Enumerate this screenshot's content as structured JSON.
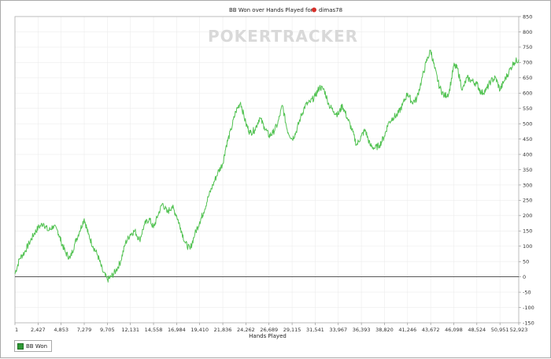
{
  "chart_data": {
    "type": "line",
    "title_prefix": "BB Won over Hands Played for",
    "title_player": "dimas78",
    "watermark": "POKERTRACKER",
    "xlabel": "Hands Played",
    "ylabel": "",
    "x_ticks": [
      "1",
      "2,427",
      "4,853",
      "7,279",
      "9,705",
      "12,131",
      "14,558",
      "16,984",
      "19,410",
      "21,836",
      "24,262",
      "26,689",
      "29,115",
      "31,541",
      "33,967",
      "36,393",
      "38,820",
      "41,246",
      "43,672",
      "46,098",
      "48,524",
      "50,951",
      "52,923"
    ],
    "x_tick_values": [
      1,
      2427,
      4853,
      7279,
      9705,
      12131,
      14558,
      16984,
      19410,
      21836,
      24262,
      26689,
      29115,
      31541,
      33967,
      36393,
      38820,
      41246,
      43672,
      46098,
      48524,
      50951,
      52923
    ],
    "xlim": [
      1,
      52923
    ],
    "ylim": [
      -150,
      850
    ],
    "y_ticks": [
      850,
      800,
      750,
      700,
      650,
      600,
      550,
      500,
      450,
      400,
      350,
      300,
      250,
      200,
      150,
      100,
      50,
      0,
      -50,
      -100,
      -150
    ],
    "grid": true,
    "legend_position": "bottom-left",
    "series": [
      {
        "name": "BB Won",
        "color": "#52c252",
        "x": [
          1,
          500,
          1000,
          1500,
          2000,
          2427,
          3000,
          3500,
          4000,
          4500,
          4853,
          5300,
          5800,
          6300,
          6800,
          7279,
          7700,
          8200,
          8700,
          9200,
          9705,
          10100,
          10600,
          11100,
          11600,
          12131,
          12600,
          13100,
          13600,
          14100,
          14558,
          15000,
          15500,
          16000,
          16500,
          16984,
          17400,
          17900,
          18400,
          18900,
          19410,
          19800,
          20300,
          20800,
          21300,
          21836,
          22200,
          22700,
          23200,
          23700,
          24262,
          24700,
          25200,
          25700,
          26200,
          26689,
          27100,
          27600,
          28100,
          28600,
          29115,
          29500,
          30000,
          30500,
          31000,
          31541,
          32000,
          32500,
          33000,
          33500,
          33967,
          34400,
          34900,
          35400,
          35900,
          36393,
          36800,
          37300,
          37800,
          38300,
          38820,
          39200,
          39700,
          40200,
          40700,
          41246,
          41700,
          42200,
          42700,
          43200,
          43672,
          44100,
          44600,
          45100,
          45600,
          46098,
          46500,
          47000,
          47500,
          48000,
          48524,
          49000,
          49500,
          50000,
          50500,
          50951,
          51400,
          51900,
          52400,
          52923
        ],
        "y": [
          10,
          60,
          80,
          110,
          140,
          160,
          175,
          150,
          165,
          150,
          115,
          80,
          60,
          110,
          150,
          190,
          140,
          100,
          70,
          20,
          -10,
          0,
          20,
          50,
          110,
          140,
          150,
          120,
          170,
          190,
          160,
          200,
          240,
          210,
          230,
          200,
          160,
          110,
          90,
          140,
          180,
          210,
          260,
          300,
          340,
          370,
          430,
          480,
          540,
          570,
          500,
          470,
          480,
          520,
          490,
          460,
          470,
          500,
          560,
          480,
          450,
          470,
          520,
          560,
          570,
          590,
          620,
          610,
          560,
          540,
          530,
          560,
          520,
          480,
          430,
          460,
          480,
          430,
          420,
          430,
          460,
          500,
          520,
          530,
          560,
          600,
          570,
          580,
          640,
          700,
          740,
          680,
          620,
          590,
          600,
          690,
          680,
          610,
          650,
          640,
          630,
          600,
          610,
          640,
          650,
          610,
          640,
          670,
          700,
          710
        ]
      }
    ]
  }
}
